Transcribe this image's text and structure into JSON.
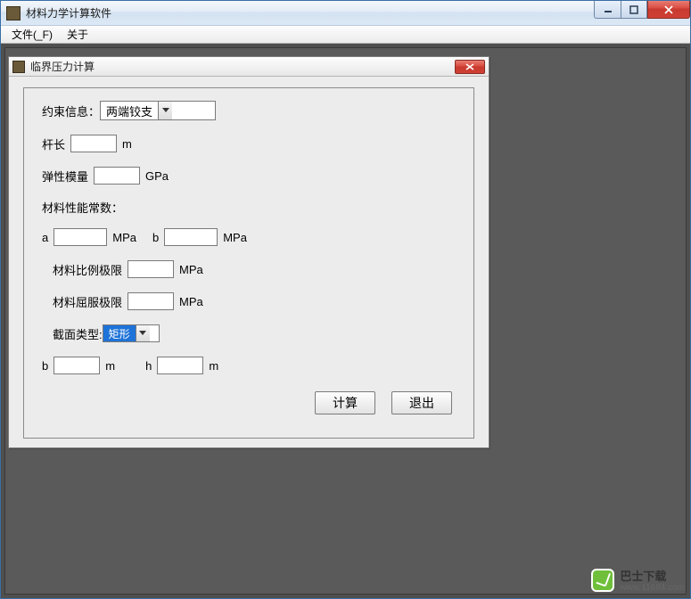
{
  "outer_window": {
    "title": "材料力学计算软件"
  },
  "menu": {
    "file": "文件(_F)",
    "about": "关于"
  },
  "dialog": {
    "title": "临界压力计算",
    "constraint_label": "约束信息：",
    "constraint_combo": {
      "selected": "两端铰支"
    },
    "bar_length_label": "杆长",
    "bar_length_unit": "m",
    "elastic_modulus_label": "弹性模量",
    "elastic_modulus_unit": "GPa",
    "material_const_header": "材料性能常数：",
    "a_label": "a",
    "a_unit": "MPa",
    "b_label": "b",
    "b_unit": "MPa",
    "prop_limit_label": "材料比例极限",
    "prop_limit_unit": "MPa",
    "yield_limit_label": "材料屈服极限",
    "yield_limit_unit": "MPa",
    "section_type_label": "截面类型:",
    "section_type_combo": {
      "selected": "矩形"
    },
    "dim_b_label": "b",
    "dim_b_unit": "m",
    "dim_h_label": "h",
    "dim_h_unit": "m",
    "buttons": {
      "calc": "计算",
      "exit": "退出"
    },
    "values": {
      "bar_length": "",
      "elastic_modulus": "",
      "a": "",
      "b": "",
      "prop_limit": "",
      "yield_limit": "",
      "dim_b": "",
      "dim_h": ""
    }
  },
  "watermark": {
    "brand": "巴士下载",
    "url": "www.11684.com"
  }
}
